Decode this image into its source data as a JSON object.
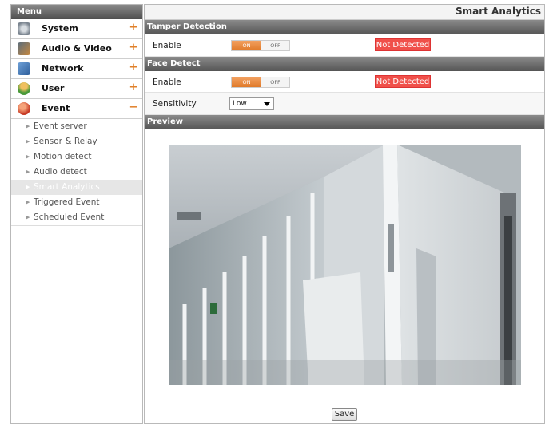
{
  "menu": {
    "header": "Menu",
    "items": [
      {
        "label": "System",
        "toggle": "+",
        "icon": "gear-icon"
      },
      {
        "label": "Audio & Video",
        "toggle": "+",
        "icon": "video-icon"
      },
      {
        "label": "Network",
        "toggle": "+",
        "icon": "network-icon"
      },
      {
        "label": "User",
        "toggle": "+",
        "icon": "user-icon"
      },
      {
        "label": "Event",
        "toggle": "−",
        "icon": "event-icon"
      }
    ],
    "event_subitems": [
      "Event server",
      "Sensor & Relay",
      "Motion detect",
      "Audio detect",
      "Smart Analytics",
      "Triggered Event",
      "Scheduled Event"
    ],
    "active_subitem": "Smart Analytics"
  },
  "page": {
    "title": "Smart Analytics",
    "tamper": {
      "header": "Tamper Detection",
      "enable_label": "Enable",
      "on": "ON",
      "off": "OFF",
      "status": "Not Detected"
    },
    "face": {
      "header": "Face Detect",
      "enable_label": "Enable",
      "on": "ON",
      "off": "OFF",
      "status": "Not Detected",
      "sensitivity_label": "Sensitivity",
      "sensitivity_value": "Low"
    },
    "preview": {
      "header": "Preview"
    },
    "save_label": "Save"
  },
  "colors": {
    "accent_on": "#e07a2a",
    "status_red": "#f0504a",
    "header_gray": "#5a5a5a"
  }
}
